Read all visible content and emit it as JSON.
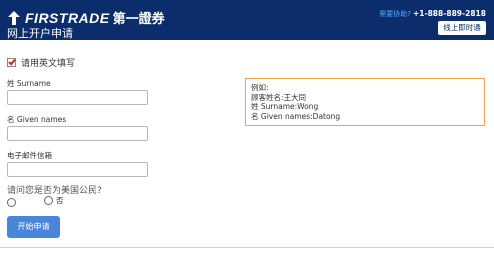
{
  "header": {
    "logo_text": "FIRSTRADE",
    "logo_cn": "第一證券",
    "subtitle": "网上开户申请",
    "phone_label": "需要协助?",
    "phone_number": "+1-888-889-2818",
    "chat_button": "线上即时通",
    "background_color": "#0b2d6b"
  },
  "form": {
    "checkbox_label": "请用英文填写",
    "checkbox_checked": true,
    "surname_label": "姓 Surname",
    "surname_value": "",
    "given_label": "名 Given names",
    "given_value": "",
    "email_label": "电子邮件信箱",
    "email_value": "",
    "citizen_question": "请问您是否为美国公民?",
    "radio_yes_label": "",
    "radio_no_label": "否",
    "start_button": "开始申请",
    "button_color": "#4a86d8"
  },
  "example": {
    "lines": [
      "例如:",
      "顾客姓名:王大同",
      "姓 Surname:Wong",
      "名 Given names:Datong"
    ],
    "border_color": "#f0a34a"
  },
  "icons": {
    "logo": "arrow-logo-icon",
    "checkbox": "checkmark-icon"
  }
}
